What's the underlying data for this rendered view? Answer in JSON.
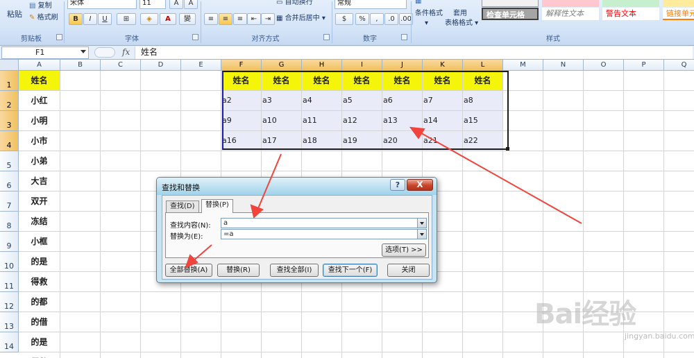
{
  "ribbon": {
    "clipboard": {
      "paste": "粘贴",
      "copy": "复制",
      "format_painter": "格式刷",
      "label": "剪贴板"
    },
    "font": {
      "font_name": "宋体",
      "font_size": "11",
      "bold": "B",
      "italic": "I",
      "underline": "U",
      "label": "字体"
    },
    "alignment": {
      "wrap": "自动换行",
      "merge": "合并后居中",
      "label": "对齐方式"
    },
    "number": {
      "format": "常规",
      "percent": "%",
      "comma": ",",
      "label": "数字"
    },
    "styles": {
      "conditional": "条件格式",
      "table_style_1": "套用",
      "table_style_2": "表格格式",
      "check_cell": "检查单元格",
      "explanatory": "解释性文本",
      "warning": "警告文本",
      "hyperlink": "链接单元",
      "label": "样式"
    }
  },
  "formula_bar": {
    "name_box": "F1",
    "fx": "fx",
    "content": "姓名"
  },
  "grid": {
    "columns": [
      "A",
      "B",
      "C",
      "D",
      "E",
      "F",
      "G",
      "H",
      "I",
      "J",
      "K",
      "L",
      "M",
      "N",
      "O",
      "P",
      "Q"
    ],
    "rows": [
      "1",
      "2",
      "3",
      "4",
      "5",
      "6",
      "7",
      "8",
      "9",
      "10",
      "11",
      "12",
      "13",
      "14"
    ],
    "col_a": [
      "姓名",
      "小红",
      "小明",
      "小市",
      "小弟",
      "大吉",
      "双开",
      "冻结",
      "小框",
      "的是",
      "得救",
      "的都",
      "的借",
      "的是",
      "得救"
    ],
    "table_header": [
      "姓名",
      "姓名",
      "姓名",
      "姓名",
      "姓名",
      "姓名",
      "姓名"
    ],
    "table_rows": [
      [
        "a2",
        "a3",
        "a4",
        "a5",
        "a6",
        "a7",
        "a8"
      ],
      [
        "a9",
        "a10",
        "a11",
        "a12",
        "a13",
        "a14",
        "a15"
      ],
      [
        "a16",
        "a17",
        "a18",
        "a19",
        "a20",
        "a21",
        "a22"
      ]
    ]
  },
  "dialog": {
    "title": "查找和替换",
    "help": "?",
    "close": "X",
    "tabs": [
      {
        "label": "查找(D)"
      },
      {
        "label": "替换(P)"
      }
    ],
    "find_label": "查找内容(N):",
    "find_value": "a",
    "replace_label": "替换为(E):",
    "replace_value": "=a",
    "options": "选项(T) >>",
    "buttons": {
      "replace_all": "全部替换(A)",
      "replace": "替换(R)",
      "find_all": "查找全部(I)",
      "find_next": "查找下一个(F)",
      "close": "关闭"
    }
  },
  "watermark": {
    "text": "Bai经验",
    "sub": "jingyan.baidu.com"
  }
}
